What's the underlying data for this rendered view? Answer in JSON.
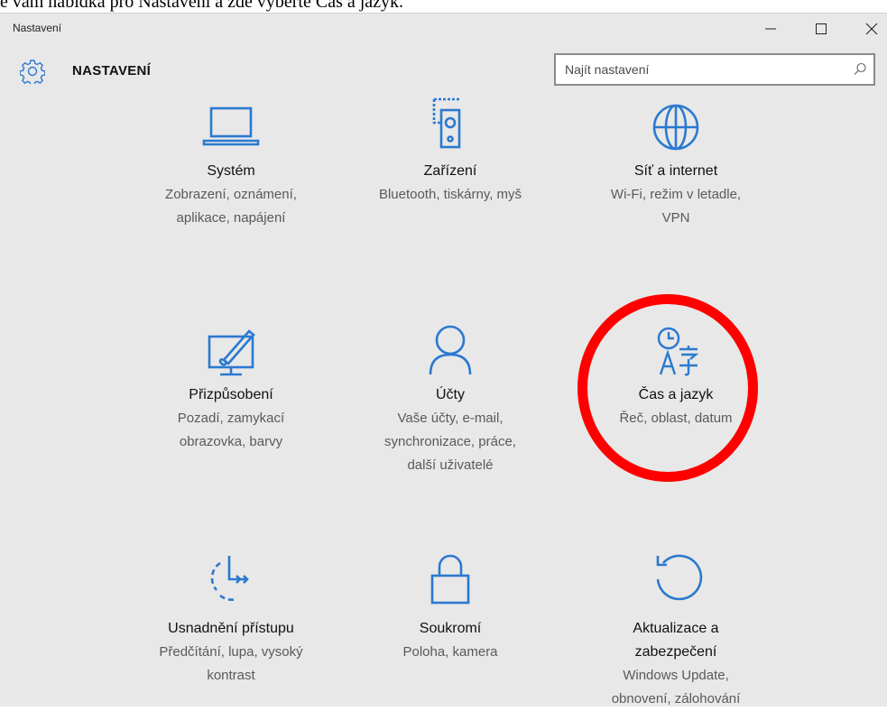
{
  "caption": "e vám nabídka pro Nastavení a zde vyberte Čas a jazyk.",
  "window": {
    "title": "Nastavení",
    "header_title": "NASTAVENÍ",
    "search_placeholder": "Najít nastavení"
  },
  "icons": {
    "gear": "gear-icon",
    "search": "search-icon",
    "minimize": "minimize-icon",
    "maximize": "maximize-icon",
    "close": "close-icon"
  },
  "accent_color": "#2b79d0",
  "highlight_color": "#ff0000",
  "tiles": [
    {
      "label": "Systém",
      "desc": [
        "Zobrazení, oznámení,",
        "aplikace, napájení"
      ],
      "icon": "laptop-icon"
    },
    {
      "label": "Zařízení",
      "desc": [
        "Bluetooth, tiskárny, myš"
      ],
      "icon": "devices-icon"
    },
    {
      "label": "Síť a internet",
      "desc": [
        "Wi-Fi, režim v letadle,",
        "VPN"
      ],
      "icon": "globe-icon"
    },
    {
      "label": "Přizpůsobení",
      "desc": [
        "Pozadí, zamykací",
        "obrazovka, barvy"
      ],
      "icon": "personalization-icon"
    },
    {
      "label": "Účty",
      "desc": [
        "Vaše účty, e-mail,",
        "synchronizace, práce,",
        "další uživatelé"
      ],
      "icon": "person-icon"
    },
    {
      "label": "Čas a jazyk",
      "desc": [
        "Řeč, oblast, datum"
      ],
      "icon": "time-language-icon"
    },
    {
      "label": "Usnadnění přístupu",
      "desc": [
        "Předčítání, lupa, vysoký",
        "kontrast"
      ],
      "icon": "accessibility-icon"
    },
    {
      "label": "Soukromí",
      "desc": [
        "Poloha, kamera"
      ],
      "icon": "lock-icon"
    },
    {
      "label": "Aktualizace a",
      "label2": "zabezpečení",
      "desc": [
        "Windows Update,",
        "obnovení, zálohování"
      ],
      "icon": "update-icon"
    }
  ]
}
